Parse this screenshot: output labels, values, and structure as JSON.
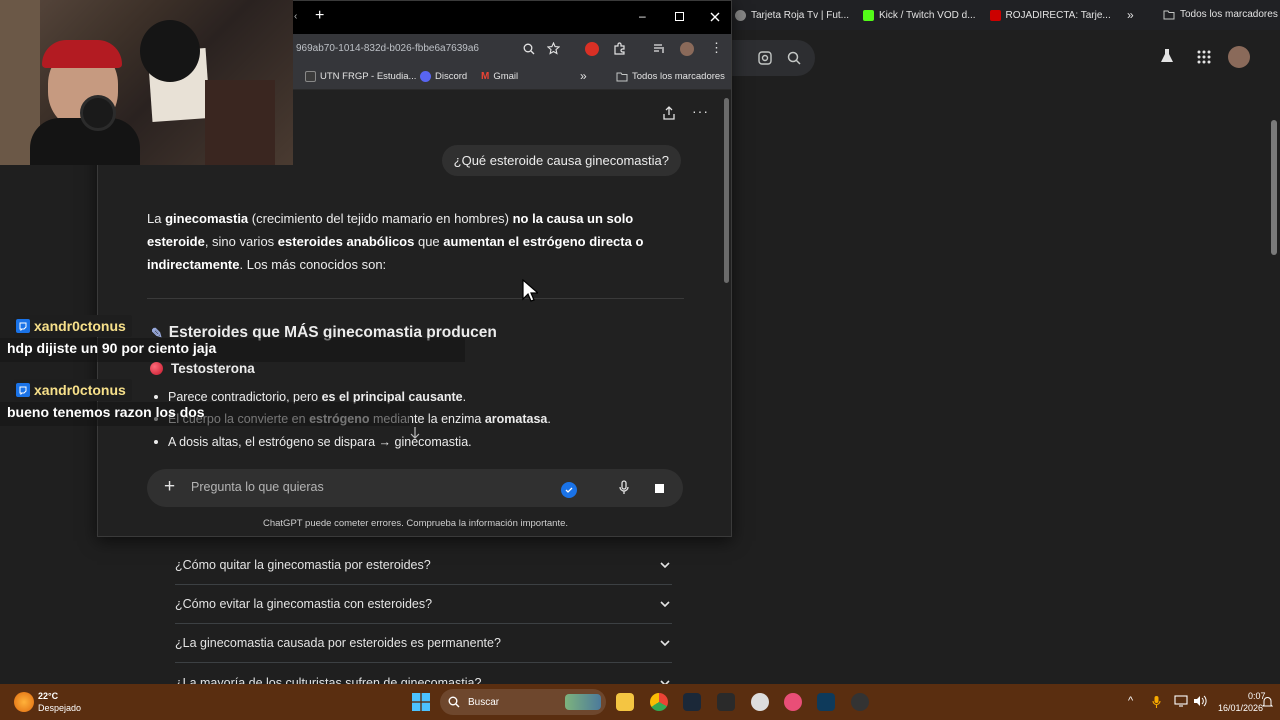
{
  "background_browser": {
    "bookmarks": [
      {
        "label": "Tarjeta Roja Tv | Fut...",
        "icon": "tv-icon"
      },
      {
        "label": "Kick / Twitch VOD d...",
        "icon": "kick-icon"
      },
      {
        "label": "ROJADIRECTA: Tarje...",
        "icon": "rojadirecta-icon"
      }
    ],
    "all_bookmarks": "Todos los marcadores",
    "faq": [
      "¿Cómo quitar la ginecomastia por esteroides?",
      "¿Cómo evitar la ginecomastia con esteroides?",
      "¿La ginecomastia causada por esteroides es permanente?",
      "¿La mayoría de los culturistas sufren de ginecomastia?"
    ]
  },
  "window": {
    "url": "969ab70-1014-832d-b026-fbbe6a7639a6",
    "bookmarks": [
      {
        "label": "UTN FRGP - Estudia..."
      },
      {
        "label": "Discord"
      },
      {
        "label": "Gmail"
      }
    ],
    "all_bookmarks": "Todos los marcadores"
  },
  "chat": {
    "user_question": "¿Qué esteroide causa ginecomastia?",
    "answer_parts": [
      {
        "t": "La ",
        "b": false
      },
      {
        "t": "ginecomastia",
        "b": true
      },
      {
        "t": " (crecimiento del tejido mamario en hombres) ",
        "b": false
      },
      {
        "t": "no la causa un solo esteroide",
        "b": true
      },
      {
        "t": ", sino varios ",
        "b": false
      },
      {
        "t": "esteroides anabólicos",
        "b": true
      },
      {
        "t": " que ",
        "b": false
      },
      {
        "t": "aumentan el estrógeno directa o indirectamente",
        "b": true
      },
      {
        "t": ". Los más conocidos son:",
        "b": false
      }
    ],
    "section_heading": "Esteroides que MÁS ginecomastia producen",
    "subheading": "Testosterona",
    "bullets": [
      [
        {
          "t": "Parece contradictorio, pero ",
          "b": false
        },
        {
          "t": "es el principal causante",
          "b": true
        },
        {
          "t": ".",
          "b": false
        }
      ],
      [
        {
          "t": "El cuerpo la convierte en ",
          "b": false
        },
        {
          "t": "estrógeno",
          "b": true
        },
        {
          "t": " mediante la enzima ",
          "b": false
        },
        {
          "t": "aromatasa",
          "b": true
        },
        {
          "t": ".",
          "b": false
        }
      ],
      [
        {
          "t": "A dosis altas, el estrógeno se dispara → ginecomastia.",
          "b": false
        }
      ]
    ],
    "composer_placeholder": "Pregunta lo que quieras",
    "disclaimer": "ChatGPT puede cometer errores. Comprueba la información importante."
  },
  "stream_chat": [
    {
      "user": "xandr0ctonus",
      "message": "hdp dijiste un 90 por ciento jaja"
    },
    {
      "user": "xandr0ctonus",
      "message": "bueno tenemos razon los dos"
    }
  ],
  "taskbar": {
    "temperature": "22°C",
    "weather": "Despejado",
    "search_label": "Buscar",
    "time": "0:07",
    "date": "16/01/2026"
  },
  "colors": {
    "taskbar": "#5a2e10",
    "chat_username": "#f7e08a",
    "accent_blue": "#1a73e8"
  }
}
